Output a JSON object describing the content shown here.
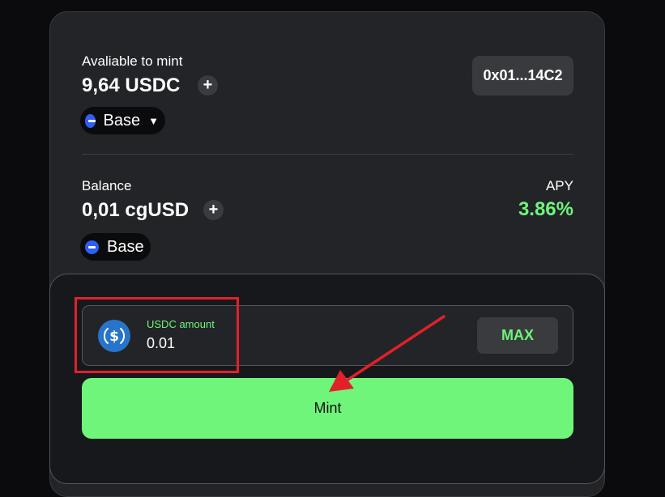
{
  "mint_section": {
    "available_label": "Avaliable to mint",
    "available_amount": "9,64 USDC",
    "chain_label": "Base",
    "address": "0x01...14C2"
  },
  "balance_section": {
    "balance_label": "Balance",
    "balance_amount": "0,01 cgUSD",
    "chain_label": "Base",
    "apy_label": "APY",
    "apy_value": "3.86%"
  },
  "mint_form": {
    "amount_label": "USDC amount",
    "amount_value": "0.01",
    "max_label": "MAX",
    "mint_label": "Mint"
  },
  "icons": {
    "plus": "+",
    "caret": "▼",
    "usdc": "usdc-icon",
    "chain": "base-chain-icon"
  },
  "colors": {
    "accent_green": "#6ef57a",
    "annotation_red": "#e2202a",
    "chain_blue": "#2f5ef2",
    "usdc_blue": "#2775ca"
  }
}
